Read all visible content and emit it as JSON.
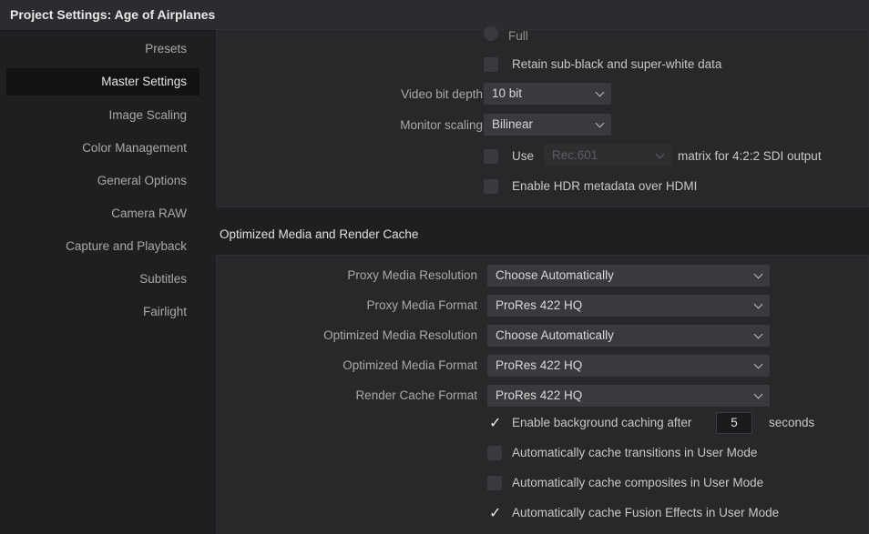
{
  "window": {
    "title": "Project Settings:  Age of Airplanes"
  },
  "sidebar": {
    "items": [
      {
        "label": "Presets"
      },
      {
        "label": "Master Settings"
      },
      {
        "label": "Image Scaling"
      },
      {
        "label": "Color Management"
      },
      {
        "label": "General Options"
      },
      {
        "label": "Camera RAW"
      },
      {
        "label": "Capture and Playback"
      },
      {
        "label": "Subtitles"
      },
      {
        "label": "Fairlight"
      }
    ],
    "active_item": "Master Settings"
  },
  "video_monitoring": {
    "full_radio_label": "Full",
    "retain_subblack_label": "Retain sub-black and super-white data",
    "retain_subblack_checked": false,
    "video_bit_depth_label": "Video bit depth",
    "video_bit_depth_value": "10 bit",
    "monitor_scaling_label": "Monitor scaling",
    "monitor_scaling_value": "Bilinear",
    "use_label": "Use",
    "use_checked": false,
    "matrix_value": "Rec.601",
    "matrix_suffix": "matrix for 4:2:2 SDI output",
    "hdr_metadata_label": "Enable HDR metadata over HDMI",
    "hdr_metadata_checked": false
  },
  "optimized_media": {
    "section_title": "Optimized Media and Render Cache",
    "proxy_resolution_label": "Proxy Media Resolution",
    "proxy_resolution_value": "Choose Automatically",
    "proxy_format_label": "Proxy Media Format",
    "proxy_format_value": "ProRes 422 HQ",
    "optimized_resolution_label": "Optimized Media Resolution",
    "optimized_resolution_value": "Choose Automatically",
    "optimized_format_label": "Optimized Media Format",
    "optimized_format_value": "ProRes 422 HQ",
    "render_cache_label": "Render Cache Format",
    "render_cache_value": "ProRes 422 HQ",
    "bg_caching_label": "Enable background caching after",
    "bg_caching_checked": true,
    "bg_caching_seconds": "5",
    "bg_caching_unit": "seconds",
    "cache_transitions_label": "Automatically cache transitions in User Mode",
    "cache_transitions_checked": false,
    "cache_composites_label": "Automatically cache composites in User Mode",
    "cache_composites_checked": false,
    "cache_fusion_label": "Automatically cache Fusion Effects in User Mode",
    "cache_fusion_checked": true,
    "checkmark_glyph": "✓"
  }
}
